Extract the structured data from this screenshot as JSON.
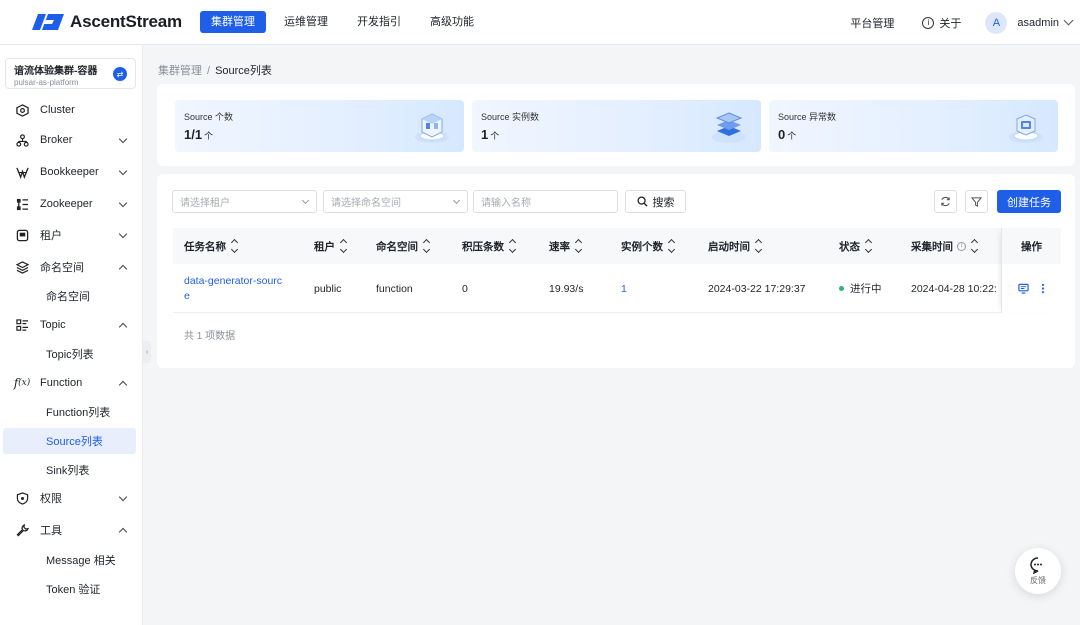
{
  "app": {
    "logo_text": "AscentStream",
    "brand_color": "#1f5fe8"
  },
  "nav": {
    "items": [
      "集群管理",
      "运维管理",
      "开发指引",
      "高级功能"
    ],
    "active_index": 0
  },
  "header_right": {
    "platform": "平台管理",
    "about": "关于",
    "avatar_letter": "A",
    "username": "asadmin"
  },
  "cluster": {
    "name": "谙流体验集群-容器",
    "sub": "pulsar-as-platform"
  },
  "sidebar": {
    "items": [
      {
        "label": "Cluster",
        "icon": "cluster-icon"
      },
      {
        "label": "Broker",
        "icon": "broker-icon"
      },
      {
        "label": "Bookkeeper",
        "icon": "bookkeeper-icon"
      },
      {
        "label": "Zookeeper",
        "icon": "zookeeper-icon"
      },
      {
        "label": "租户",
        "icon": "tenant-icon"
      },
      {
        "label": "命名空间",
        "icon": "namespace-icon"
      },
      {
        "label": "Topic",
        "icon": "topic-icon"
      },
      {
        "label": "Function",
        "icon": "function-icon"
      },
      {
        "label": "权限",
        "icon": "permission-icon"
      },
      {
        "label": "工具",
        "icon": "tool-icon"
      }
    ],
    "sub_items": {
      "namespace_list": "命名空间",
      "topic_list": "Topic列表",
      "function_list": "Function列表",
      "source_list": "Source列表",
      "sink_list": "Sink列表",
      "message": "Message 相关",
      "token": "Token 验证"
    }
  },
  "breadcrumb": {
    "parent": "集群管理",
    "current": "Source列表"
  },
  "stats": [
    {
      "label": "Source 个数",
      "value": "1/1",
      "unit": "个"
    },
    {
      "label": "Source 实例数",
      "value": "1",
      "unit": "个"
    },
    {
      "label": "Source 异常数",
      "value": "0",
      "unit": "个"
    }
  ],
  "filters": {
    "tenant_placeholder": "请选择租户",
    "namespace_placeholder": "请选择命名空间",
    "name_placeholder": "请输入名称",
    "search_label": "搜索",
    "create_label": "创建任务"
  },
  "table": {
    "columns": [
      "任务名称",
      "租户",
      "命名空间",
      "积压条数",
      "速率",
      "实例个数",
      "启动时间",
      "状态",
      "采集时间",
      "操作"
    ],
    "rows": [
      {
        "name_line1": "data-generator-sourc",
        "name_line2": "e",
        "tenant": "public",
        "namespace": "function",
        "backlog": "0",
        "rate": "19.93/s",
        "instances": "1",
        "start_time": "2024-03-22 17:29:37",
        "status": "进行中",
        "collect_time": "2024-04-28 10:22:"
      }
    ],
    "total": "共 1 项数据"
  },
  "feedback": {
    "label": "反馈"
  }
}
